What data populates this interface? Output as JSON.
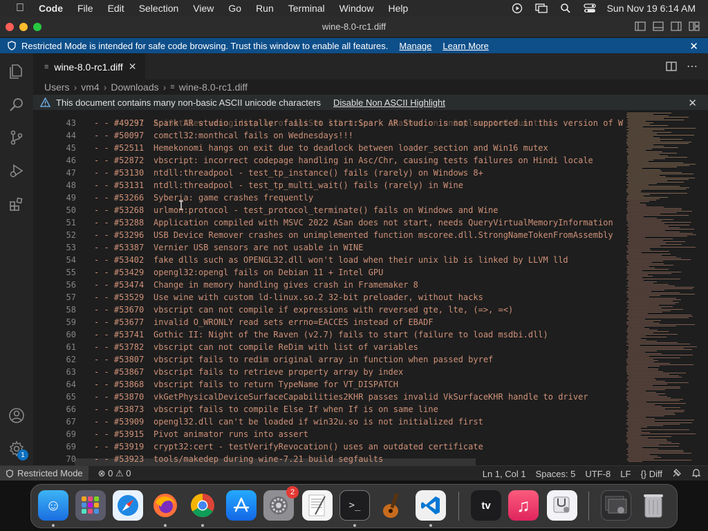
{
  "menubar": {
    "app": "Code",
    "items": [
      "File",
      "Edit",
      "Selection",
      "View",
      "Go",
      "Run",
      "Terminal",
      "Window",
      "Help"
    ],
    "clock": "Sun Nov 19  6:14 AM"
  },
  "window": {
    "title": "wine-8.0-rc1.diff"
  },
  "banner": {
    "message": "Restricted Mode is intended for safe code browsing. Trust this window to enable all features.",
    "manage": "Manage",
    "learn_more": "Learn More"
  },
  "tab": {
    "label": "wine-8.0-rc1.diff"
  },
  "breadcrumb": {
    "parts": [
      "Users",
      "vm4",
      "Downloads",
      "wine-8.0-rc1.diff"
    ]
  },
  "warning": {
    "message": "This document contains many non-basic ASCII unicode characters",
    "action": "Disable Non ASCII Highlight"
  },
  "editor": {
    "lines": [
      {
        "n": "43",
        "m": "- - #49297",
        "t": "Spark AR studio installer fails to start:Spark AR Studio is not supported in this version of W"
      },
      {
        "n": "44",
        "m": "- - #50097",
        "t": "comctl32:monthcal fails on Wednesdays!!!"
      },
      {
        "n": "45",
        "m": "- - #52511",
        "t": "Hemekonomi hangs on exit due to deadlock between loader_section and Win16 mutex"
      },
      {
        "n": "46",
        "m": "- - #52872",
        "t": "vbscript: incorrect codepage handling in Asc/Chr, causing tests failures on Hindi locale"
      },
      {
        "n": "47",
        "m": "- - #53130",
        "t": "ntdll:threadpool - test_tp_instance() fails (rarely) on Windows 8+"
      },
      {
        "n": "48",
        "m": "- - #53131",
        "t": "ntdll:threadpool - test_tp_multi_wait() fails (rarely) in Wine"
      },
      {
        "n": "49",
        "m": "- - #53266",
        "t": "Syberia: game crashes frequently"
      },
      {
        "n": "50",
        "m": "- - #53268",
        "t": "urlmon:protocol - test_protocol_terminate() fails on Windows and Wine"
      },
      {
        "n": "51",
        "m": "- - #53288",
        "t": "Application compiled with MSVC 2022 ASan does not start, needs QueryVirtualMemoryInformation"
      },
      {
        "n": "52",
        "m": "- - #53296",
        "t": "USB Device Remover crashes on unimplemented function mscoree.dll.StrongNameTokenFromAssembly"
      },
      {
        "n": "53",
        "m": "- - #53387",
        "t": "Vernier USB sensors are not usable in WINE"
      },
      {
        "n": "54",
        "m": "- - #53402",
        "t": "fake dlls such as OPENGL32.dll won't load when their unix lib is linked by LLVM lld"
      },
      {
        "n": "55",
        "m": "- - #53429",
        "t": "opengl32:opengl fails on Debian 11 + Intel GPU"
      },
      {
        "n": "56",
        "m": "- - #53474",
        "t": "Change in memory handling gives crash in Framemaker 8"
      },
      {
        "n": "57",
        "m": "- - #53529",
        "t": "Use wine with custom ld-linux.so.2 32-bit preloader, without hacks"
      },
      {
        "n": "58",
        "m": "- - #53670",
        "t": "vbscript can not compile if expressions with reversed gte, lte, (=>, =<)"
      },
      {
        "n": "59",
        "m": "- - #53677",
        "t": "invalid O_WRONLY read sets errno=EACCES instead of EBADF"
      },
      {
        "n": "60",
        "m": "- - #53741",
        "t": "Gothic II: Night of the Raven (v2.7) fails to start (failure to load msdbi.dll)"
      },
      {
        "n": "61",
        "m": "- - #53782",
        "t": "vbscript can not compile ReDim with list of variables"
      },
      {
        "n": "62",
        "m": "- - #53807",
        "t": "vbscript fails to redim original array in function when passed byref"
      },
      {
        "n": "63",
        "m": "- - #53867",
        "t": "vbscript fails to retrieve property array by index"
      },
      {
        "n": "64",
        "m": "- - #53868",
        "t": "vbscript fails to return TypeName for VT_DISPATCH"
      },
      {
        "n": "65",
        "m": "- - #53870",
        "t": "vkGetPhysicalDeviceSurfaceCapabilities2KHR passes invalid VkSurfaceKHR handle to driver"
      },
      {
        "n": "66",
        "m": "- - #53873",
        "t": "vbscript fails to compile Else If when If is on same line"
      },
      {
        "n": "67",
        "m": "- - #53909",
        "t": "opengl32.dll can't be loaded if win32u.so is not initialized first"
      },
      {
        "n": "69",
        "m": "- - #53915",
        "t": "Pivot animator runs into assert"
      },
      {
        "n": "69",
        "m": "- - #53919",
        "t": "crypt32:cert - testVerifyRevocation() uses an outdated certificate"
      },
      {
        "n": "70",
        "m": "- - #53923",
        "t": "tools/makedep during wine-7.21 build segfaults"
      }
    ]
  },
  "status": {
    "restricted": "Restricted Mode",
    "problems": "⊗ 0 ⚠ 0",
    "position": "Ln 1, Col 1",
    "spaces": "Spaces: 5",
    "encoding": "UTF-8",
    "eol": "LF",
    "language": "{} Diff"
  },
  "activity": {
    "badge": "1"
  },
  "dock": {
    "settings_badge": "2"
  },
  "colors": {
    "accent": "#0e70c0",
    "banner": "#0e4f8a",
    "text_diff": "#ce9178"
  }
}
